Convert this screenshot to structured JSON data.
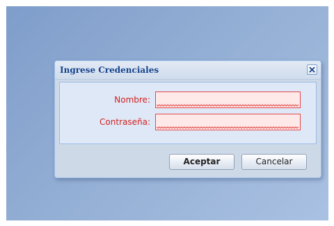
{
  "dialog": {
    "title": "Ingrese Credenciales",
    "close_icon": "close-icon"
  },
  "form": {
    "name_label": "Nombre:",
    "name_value": "",
    "password_label": "Contraseña:",
    "password_value": ""
  },
  "buttons": {
    "ok_label": "Aceptar",
    "cancel_label": "Cancelar"
  },
  "colors": {
    "title": "#15428b",
    "label_error": "#d32020",
    "input_error_border": "#e04848",
    "input_error_bg": "#ffe8e8",
    "dialog_bg": "#ced9e7",
    "panel_bg": "#dfe8f6"
  }
}
